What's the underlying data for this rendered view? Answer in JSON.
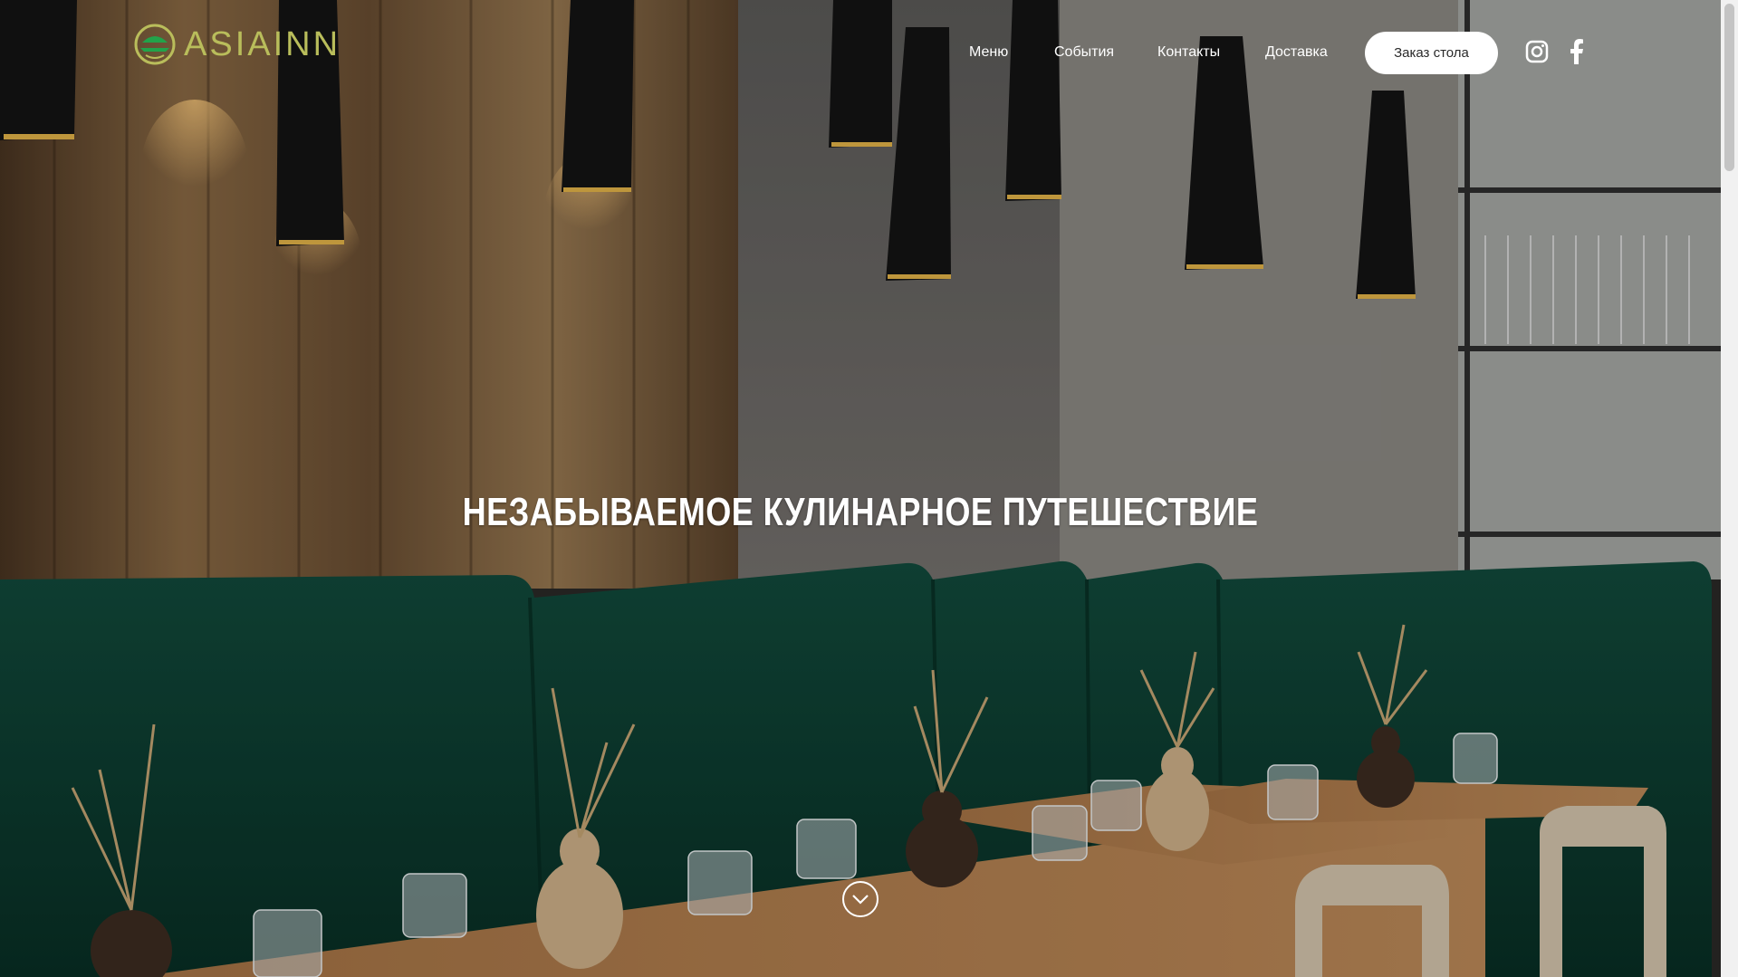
{
  "brand": {
    "name": "ASIAINN",
    "color": "#b9bd5b"
  },
  "nav": {
    "items": [
      {
        "label": "Меню"
      },
      {
        "label": "События"
      },
      {
        "label": "Контакты"
      },
      {
        "label": "Доставка"
      }
    ],
    "reserve_label": "Заказ стола"
  },
  "social": [
    {
      "icon": "instagram-icon"
    },
    {
      "icon": "facebook-icon"
    }
  ],
  "hero": {
    "headline": "НЕЗАБЫВАЕМОЕ КУЛИНАРНОЕ ПУТЕШЕСТВИЕ",
    "scroll_icon": "chevron-down-icon"
  },
  "colors": {
    "sofa_green": "#0f4a3c",
    "wood": "#8a6a45",
    "table_wood": "#b07d4c",
    "wall_gray": "#6f6d6a"
  }
}
